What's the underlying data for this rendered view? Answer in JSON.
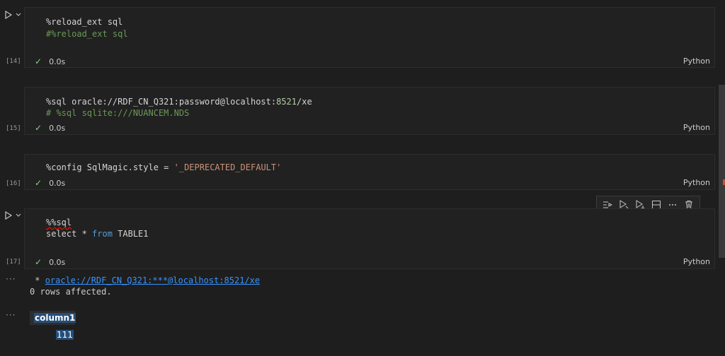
{
  "cells": [
    {
      "exec_count": "[14]",
      "lines": [
        [
          {
            "t": "%reload_ext sql",
            "c": "#d4d4d4"
          }
        ],
        [
          {
            "t": "#%reload_ext sql",
            "c": "#6a9955"
          }
        ]
      ],
      "time": "0.0s",
      "language": "Python"
    },
    {
      "exec_count": "[15]",
      "line1": {
        "prefix": "%sql oracle://RDF_CN_Q321:password@localhost:",
        "number": "8521",
        "suffix": "/xe"
      },
      "line2": "# %sql sqlite:///NUANCEM.NDS",
      "time": "0.0s",
      "language": "Python"
    },
    {
      "exec_count": "[16]",
      "line1": {
        "prefix": "%config SqlMagic.style = ",
        "string": "'_DEPRECATED_DEFAULT'"
      },
      "time": "0.0s",
      "language": "Python"
    },
    {
      "exec_count": "[17]",
      "line1": "%%sql",
      "line2": {
        "select": "select * ",
        "from": "from",
        "rest": " TABLE1"
      },
      "time": "0.0s",
      "language": "Python"
    }
  ],
  "output": {
    "connection_prefix": " * ",
    "connection_link": "oracle://RDF_CN_Q321:***@localhost:8521/xe",
    "rows_affected": "0 rows affected.",
    "table": {
      "header": "column1",
      "rows": [
        "111"
      ]
    }
  },
  "toolbar": {
    "icons": [
      "run-by-line-icon",
      "execute-above-icon",
      "execute-below-icon",
      "split-cell-icon",
      "more-actions-icon",
      "delete-cell-icon"
    ]
  },
  "colors": {
    "check": "#89d185",
    "comment": "#6a9955",
    "number": "#b5cea8",
    "string": "#ce9178",
    "keyword": "#569cd6",
    "link": "#3794ff",
    "selection": "#264f78"
  }
}
